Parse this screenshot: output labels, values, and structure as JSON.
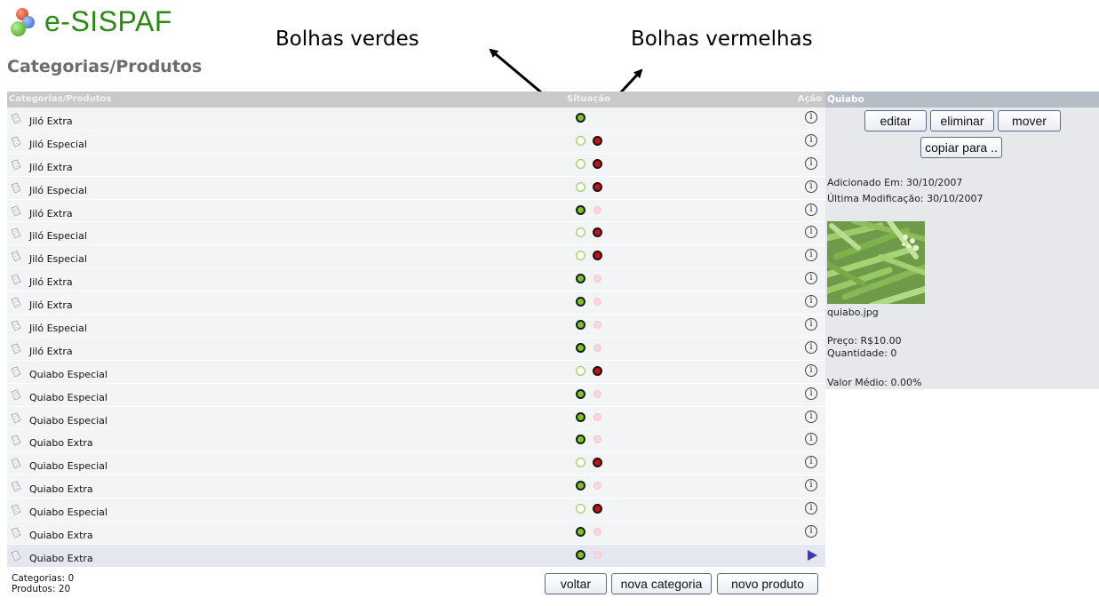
{
  "app": {
    "name": "e-SISPAF"
  },
  "page": {
    "title": "Categorias/Produtos"
  },
  "annotations": {
    "green_label": "Bolhas verdes",
    "red_label": "Bolhas vermelhas"
  },
  "grid": {
    "columns": {
      "name": "Categorias/Produtos",
      "status": "Situação",
      "action": "Ação"
    },
    "rows": [
      {
        "label": "Jiló Extra",
        "green": "on",
        "red": "none",
        "action": "info-icon"
      },
      {
        "label": "Jiló Especial",
        "green": "off",
        "red": "on",
        "action": "info-icon"
      },
      {
        "label": "Jiló Extra",
        "green": "off",
        "red": "on",
        "action": "info-icon"
      },
      {
        "label": "Jiló Especial",
        "green": "off",
        "red": "on",
        "action": "info-icon"
      },
      {
        "label": "Jiló Extra",
        "green": "on",
        "red": "off",
        "action": "info-icon"
      },
      {
        "label": "Jiló Especial",
        "green": "off",
        "red": "on",
        "action": "info-icon"
      },
      {
        "label": "Jiló Especial",
        "green": "off",
        "red": "on",
        "action": "info-icon"
      },
      {
        "label": "Jiló Extra",
        "green": "on",
        "red": "off",
        "action": "info-icon"
      },
      {
        "label": "Jiló Extra",
        "green": "on",
        "red": "off",
        "action": "info-icon"
      },
      {
        "label": "Jiló Especial",
        "green": "on",
        "red": "off",
        "action": "info-icon"
      },
      {
        "label": "Jiló Extra",
        "green": "on",
        "red": "off",
        "action": "info-icon"
      },
      {
        "label": "Quiabo Especial",
        "green": "off",
        "red": "on",
        "action": "info-icon"
      },
      {
        "label": "Quiabo Especial",
        "green": "on",
        "red": "off",
        "action": "info-icon"
      },
      {
        "label": "Quiabo Especial",
        "green": "on",
        "red": "off",
        "action": "info-icon"
      },
      {
        "label": "Quiabo Extra",
        "green": "on",
        "red": "off",
        "action": "info-icon"
      },
      {
        "label": "Quiabo Especial",
        "green": "off",
        "red": "on",
        "action": "info-icon"
      },
      {
        "label": "Quiabo Extra",
        "green": "on",
        "red": "off",
        "action": "info-icon"
      },
      {
        "label": "Quiabo Especial",
        "green": "off",
        "red": "on",
        "action": "info-icon"
      },
      {
        "label": "Quiabo Extra",
        "green": "on",
        "red": "off",
        "action": "info-icon"
      },
      {
        "label": "Quiabo Extra",
        "green": "on",
        "red": "off",
        "action": "play-icon",
        "selected": true
      }
    ]
  },
  "footer": {
    "categories": "Categorias: 0",
    "products": "Produtos: 20",
    "buttons": {
      "back": "voltar",
      "new_category": "nova categoria",
      "new_product": "novo produto"
    }
  },
  "detail": {
    "title": "Quiabo",
    "buttons": {
      "edit": "editar",
      "delete": "eliminar",
      "move": "mover",
      "copy": "copiar para .."
    },
    "added": "Adicionado Em: 30/10/2007",
    "modified": "Última Modificação: 30/10/2007",
    "image_filename": "quiabo.jpg",
    "price": "Preço: R$10.00",
    "quantity": "Quantidade: 0",
    "average": "Valor Médio: 0.00%"
  },
  "colors": {
    "logo": "#2d8a11",
    "green_bubble": "#7bc51f",
    "red_bubble": "#b31818",
    "header_bg": "#c9c9c9"
  }
}
